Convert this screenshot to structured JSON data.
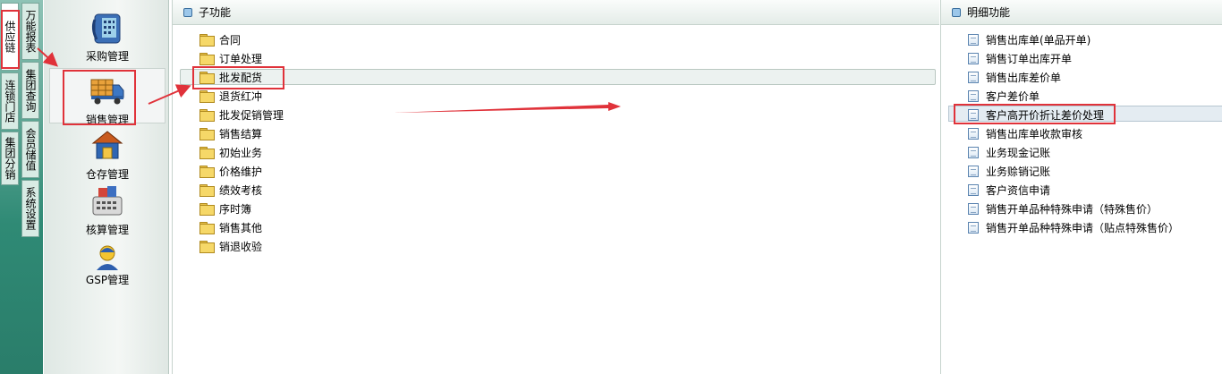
{
  "nav_tabs": [
    {
      "label": "供应链",
      "active": true
    },
    {
      "label": "连锁门店",
      "active": false
    },
    {
      "label": "集团分销",
      "active": false
    }
  ],
  "nav_tabs_2": [
    {
      "label": "万能报表"
    },
    {
      "label": "集团查询"
    },
    {
      "label": "会员储值"
    },
    {
      "label": "系统设置"
    }
  ],
  "modules": [
    {
      "label": "采购管理",
      "icon": "phone-calculator-icon"
    },
    {
      "label": "销售管理",
      "icon": "delivery-truck-icon",
      "selected": true
    },
    {
      "label": "仓存管理",
      "icon": "warehouse-icon"
    },
    {
      "label": "核算管理",
      "icon": "calculator-icon"
    },
    {
      "label": "GSP管理",
      "icon": "person-icon"
    }
  ],
  "sub_panel": {
    "title": "子功能",
    "items": [
      "合同",
      "订单处理",
      "批发配货",
      "退货红冲",
      "批发促销管理",
      "销售结算",
      "初始业务",
      "价格维护",
      "绩效考核",
      "序时簿",
      "销售其他",
      "销退收验"
    ],
    "selected": "批发配货"
  },
  "detail_panel": {
    "title": "明细功能",
    "items": [
      "销售出库单(单品开单)",
      "销售订单出库开单",
      "销售出库差价单",
      "客户差价单",
      "客户高开价折让差价处理",
      "销售出库单收款审核",
      "业务现金记账",
      "业务赊销记账",
      "客户资信申请",
      "销售开单品种特殊申请（特殊售价）",
      "销售开单品种特殊申请（贴点特殊售价）"
    ],
    "selected": "客户高开价折让差价处理"
  },
  "colors": {
    "annotation": "#e0323a",
    "strip": "#2f8a75"
  }
}
